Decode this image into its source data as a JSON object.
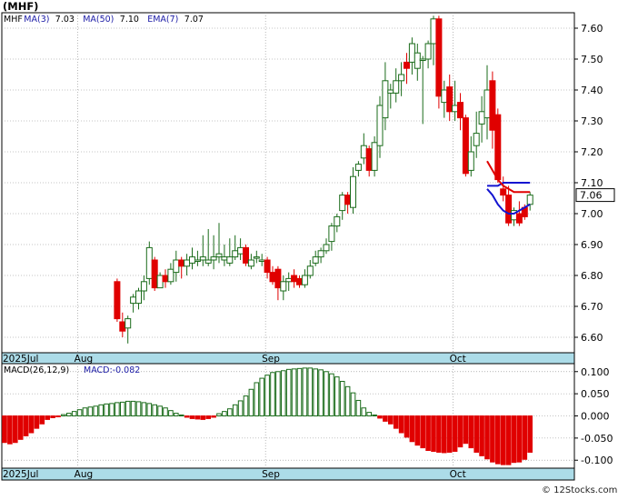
{
  "chart_data": [
    {
      "type": "candlestick",
      "title": "(MHF)",
      "legend": [
        {
          "label": "MHF",
          "color": "#000000"
        },
        {
          "label": "MA(3)",
          "value": "7.03",
          "color": "#1a1aa6"
        },
        {
          "label": "MA(50)",
          "value": "7.10",
          "color": "#1a1aa6"
        },
        {
          "label": "EMA(7)",
          "value": "7.07",
          "color": "#1a1aa6"
        }
      ],
      "last_price": "7.06",
      "ylim": [
        6.55,
        7.65
      ],
      "y_ticks": [
        "7.60",
        "7.50",
        "7.40",
        "7.30",
        "7.20",
        "7.10",
        "7.00",
        "6.90",
        "6.80",
        "6.70",
        "6.60"
      ],
      "x_ticks": [
        {
          "label": "2025Jul",
          "index": 0
        },
        {
          "label": "Aug",
          "index": 14
        },
        {
          "label": "Sep",
          "index": 49
        },
        {
          "label": "Oct",
          "index": 84
        }
      ],
      "colors": {
        "up": "#1a6b1a",
        "down": "#e00000",
        "ma3": "#1414d0",
        "ma50": "#1414d0",
        "ema7": "#e00000",
        "axis_band": "#acdce8"
      },
      "candles": [
        [
          6.78,
          6.66,
          6.79,
          6.65
        ],
        [
          6.65,
          6.62,
          6.68,
          6.6
        ],
        [
          6.63,
          6.66,
          6.67,
          6.58
        ],
        [
          6.71,
          6.73,
          6.74,
          6.68
        ],
        [
          6.71,
          6.75,
          6.76,
          6.69
        ],
        [
          6.75,
          6.78,
          6.8,
          6.72
        ],
        [
          6.79,
          6.89,
          6.91,
          6.77
        ],
        [
          6.85,
          6.76,
          6.86,
          6.75
        ],
        [
          6.76,
          6.8,
          6.81,
          6.77
        ],
        [
          6.8,
          6.78,
          6.82,
          6.76
        ],
        [
          6.78,
          6.82,
          6.84,
          6.77
        ],
        [
          6.81,
          6.85,
          6.88,
          6.78
        ],
        [
          6.85,
          6.83,
          6.86,
          6.79
        ],
        [
          6.83,
          6.85,
          6.87,
          6.8
        ],
        [
          6.84,
          6.86,
          6.89,
          6.82
        ],
        [
          6.85,
          6.85,
          6.88,
          6.83
        ],
        [
          6.85,
          6.86,
          6.93,
          6.83
        ],
        [
          6.84,
          6.85,
          6.95,
          6.83
        ],
        [
          6.85,
          6.86,
          6.93,
          6.82
        ],
        [
          6.86,
          6.87,
          6.97,
          6.84
        ],
        [
          6.85,
          6.86,
          6.9,
          6.83
        ],
        [
          6.84,
          6.86,
          6.92,
          6.83
        ],
        [
          6.86,
          6.88,
          6.93,
          6.85
        ],
        [
          6.87,
          6.89,
          6.92,
          6.85
        ],
        [
          6.89,
          6.84,
          6.9,
          6.83
        ],
        [
          6.83,
          6.85,
          6.87,
          6.82
        ],
        [
          6.86,
          6.86,
          6.88,
          6.84
        ],
        [
          6.85,
          6.85,
          6.87,
          6.83
        ],
        [
          6.85,
          6.81,
          6.86,
          6.79
        ],
        [
          6.81,
          6.78,
          6.83,
          6.77
        ],
        [
          6.82,
          6.76,
          6.83,
          6.72
        ],
        [
          6.75,
          6.78,
          6.8,
          6.72
        ],
        [
          6.78,
          6.79,
          6.81,
          6.75
        ],
        [
          6.8,
          6.78,
          6.82,
          6.76
        ],
        [
          6.79,
          6.77,
          6.8,
          6.76
        ],
        [
          6.77,
          6.8,
          6.82,
          6.76
        ],
        [
          6.8,
          6.83,
          6.85,
          6.79
        ],
        [
          6.84,
          6.86,
          6.88,
          6.83
        ],
        [
          6.86,
          6.88,
          6.89,
          6.84
        ],
        [
          6.88,
          6.9,
          6.92,
          6.87
        ],
        [
          6.91,
          6.96,
          6.97,
          6.88
        ],
        [
          6.96,
          6.99,
          7.0,
          6.94
        ],
        [
          7.01,
          7.06,
          7.07,
          6.98
        ],
        [
          7.06,
          7.03,
          7.07,
          7.0
        ],
        [
          7.02,
          7.12,
          7.15,
          7.0
        ],
        [
          7.14,
          7.16,
          7.17,
          7.12
        ],
        [
          7.18,
          7.22,
          7.26,
          7.16
        ],
        [
          7.21,
          7.14,
          7.22,
          7.12
        ],
        [
          7.14,
          7.23,
          7.25,
          7.12
        ],
        [
          7.22,
          7.35,
          7.38,
          7.18
        ],
        [
          7.31,
          7.43,
          7.49,
          7.27
        ],
        [
          7.39,
          7.4,
          7.42,
          7.34
        ],
        [
          7.39,
          7.43,
          7.47,
          7.36
        ],
        [
          7.43,
          7.45,
          7.49,
          7.38
        ],
        [
          7.49,
          7.47,
          7.52,
          7.42
        ],
        [
          7.49,
          7.55,
          7.57,
          7.45
        ],
        [
          7.47,
          7.52,
          7.55,
          7.43
        ],
        [
          7.5,
          7.5,
          7.51,
          7.29
        ],
        [
          7.5,
          7.55,
          7.56,
          7.47
        ],
        [
          7.55,
          7.63,
          7.64,
          7.48
        ],
        [
          7.63,
          7.38,
          7.64,
          7.34
        ],
        [
          7.36,
          7.4,
          7.43,
          7.31
        ],
        [
          7.41,
          7.33,
          7.45,
          7.3
        ],
        [
          7.33,
          7.35,
          7.43,
          7.3
        ],
        [
          7.36,
          7.31,
          7.39,
          7.27
        ],
        [
          7.31,
          7.13,
          7.32,
          7.12
        ],
        [
          7.14,
          7.2,
          7.25,
          7.12
        ],
        [
          7.22,
          7.26,
          7.33,
          7.18
        ],
        [
          7.29,
          7.33,
          7.38,
          7.23
        ],
        [
          7.31,
          7.4,
          7.48,
          7.24
        ],
        [
          7.43,
          7.27,
          7.46,
          7.21
        ],
        [
          7.32,
          7.11,
          7.34,
          7.1
        ],
        [
          7.08,
          7.06,
          7.12,
          7.04
        ],
        [
          7.06,
          6.97,
          7.09,
          6.96
        ],
        [
          6.98,
          7.01,
          7.02,
          6.96
        ],
        [
          7.0,
          6.97,
          7.04,
          6.96
        ],
        [
          7.02,
          6.99,
          7.03,
          6.98
        ],
        [
          7.03,
          7.06,
          7.07,
          7.01
        ]
      ],
      "ma3": [
        7.08,
        7.06,
        7.03,
        7.01,
        7.0,
        7.0,
        7.01,
        7.02,
        7.03
      ],
      "ma50": [
        7.09,
        7.09,
        7.09,
        7.1,
        7.1,
        7.1,
        7.1,
        7.1,
        7.1
      ],
      "ema7": [
        7.17,
        7.14,
        7.11,
        7.09,
        7.08,
        7.07,
        7.07,
        7.07,
        7.07
      ]
    },
    {
      "type": "bar",
      "title": "MACD(26,12,9)",
      "value_label": "MACD:-0.082",
      "ylim": [
        -0.118,
        0.118
      ],
      "y_ticks": [
        "0.100",
        "0.050",
        "0.000",
        "-0.050",
        "-0.100"
      ],
      "x_ticks": [
        {
          "label": "2025Jul",
          "index": 0
        },
        {
          "label": "Aug",
          "index": 14
        },
        {
          "label": "Sep",
          "index": 49
        },
        {
          "label": "Oct",
          "index": 84
        }
      ],
      "values": [
        -0.06,
        -0.063,
        -0.06,
        -0.053,
        -0.045,
        -0.038,
        -0.028,
        -0.018,
        -0.008,
        -0.004,
        -0.002,
        0.003,
        0.006,
        0.01,
        0.014,
        0.018,
        0.02,
        0.022,
        0.025,
        0.027,
        0.028,
        0.03,
        0.031,
        0.033,
        0.033,
        0.032,
        0.03,
        0.028,
        0.025,
        0.022,
        0.018,
        0.012,
        0.006,
        0.002,
        -0.003,
        -0.006,
        -0.007,
        -0.008,
        -0.006,
        -0.003,
        0.005,
        0.01,
        0.016,
        0.025,
        0.034,
        0.045,
        0.06,
        0.075,
        0.085,
        0.092,
        0.098,
        0.1,
        0.102,
        0.105,
        0.106,
        0.107,
        0.108,
        0.108,
        0.106,
        0.104,
        0.1,
        0.095,
        0.088,
        0.078,
        0.066,
        0.052,
        0.035,
        0.018,
        0.008,
        0.002,
        -0.005,
        -0.012,
        -0.018,
        -0.028,
        -0.038,
        -0.048,
        -0.058,
        -0.066,
        -0.072,
        -0.078,
        -0.08,
        -0.082,
        -0.083,
        -0.082,
        -0.08,
        -0.07,
        -0.062,
        -0.072,
        -0.082,
        -0.09,
        -0.097,
        -0.104,
        -0.108,
        -0.11,
        -0.11,
        -0.105,
        -0.104,
        -0.098,
        -0.082
      ]
    }
  ],
  "footer": "© 12Stocks.com"
}
